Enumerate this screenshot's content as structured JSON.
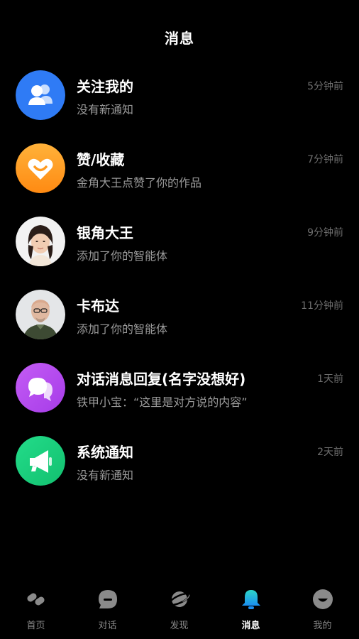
{
  "header": {
    "title": "消息"
  },
  "messages": [
    {
      "name": "关注我的",
      "preview": "没有新通知",
      "time": "5分钟前",
      "icon": "followers-icon",
      "color": "#2f7bf5"
    },
    {
      "name": "赞/收藏",
      "preview": "金角大王点赞了你的作品",
      "time": "7分钟前",
      "icon": "heart-like-icon",
      "color": "#ff9a1f"
    },
    {
      "name": "银角大王",
      "preview": "添加了你的智能体",
      "time": "9分钟前",
      "icon": "user-avatar-woman"
    },
    {
      "name": "卡布达",
      "preview": "添加了你的智能体",
      "time": "11分钟前",
      "icon": "user-avatar-man"
    },
    {
      "name": "对话消息回复(名字没想好)",
      "preview": "铁甲小宝：“这里是对方说的内容”",
      "time": "1天前",
      "icon": "chat-bubbles-icon",
      "color": "#b44ef0"
    },
    {
      "name": "系统通知",
      "preview": "没有新通知",
      "time": "2天前",
      "icon": "megaphone-icon",
      "color": "#19d07e"
    }
  ],
  "tabbar": {
    "tabs": [
      {
        "label": "首页",
        "icon": "home-icon"
      },
      {
        "label": "对话",
        "icon": "chat-icon"
      },
      {
        "label": "发现",
        "icon": "planet-icon"
      },
      {
        "label": "消息",
        "icon": "bell-icon",
        "active": true
      },
      {
        "label": "我的",
        "icon": "profile-icon"
      }
    ]
  }
}
